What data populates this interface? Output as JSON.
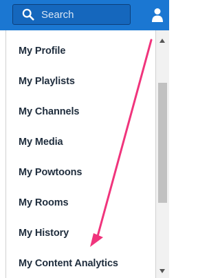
{
  "header": {
    "search_placeholder": "Search",
    "search_icon": "search-icon",
    "user_icon": "user-icon",
    "bar_color": "#1b77d2"
  },
  "menu": {
    "items": [
      {
        "label": "My Profile"
      },
      {
        "label": "My Playlists"
      },
      {
        "label": "My Channels"
      },
      {
        "label": "My Media"
      },
      {
        "label": "My Powtoons"
      },
      {
        "label": "My Rooms"
      },
      {
        "label": "My History"
      },
      {
        "label": "My Content Analytics"
      }
    ]
  },
  "annotation": {
    "arrow_color": "#f0347c"
  }
}
